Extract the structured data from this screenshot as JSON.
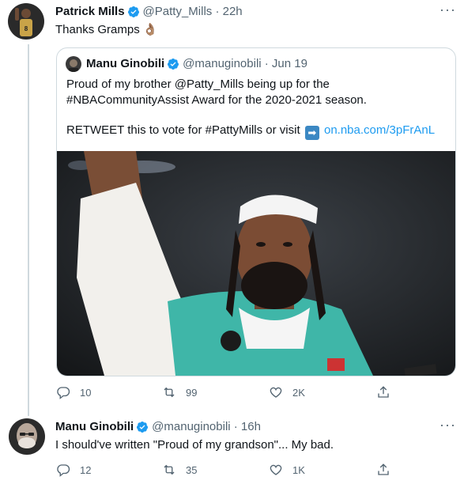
{
  "tweet1": {
    "name": "Patrick Mills",
    "handle": "@Patty_Mills · 22h",
    "text": "Thanks Gramps",
    "emoji": "👌🏽",
    "actions": {
      "reply": "10",
      "retweet": "99",
      "like": "2K"
    }
  },
  "quote": {
    "name": "Manu Ginobili",
    "handle": "@manuginobili · Jun 19",
    "line1": "Proud of my brother @Patty_Mills being up for the",
    "line2": "#NBACommunityAssist Award for the 2020-2021 season.",
    "line3_prefix": "RETWEET this to vote for #PattyMills or visit",
    "arrow": "➡",
    "link": "on.nba.com/3pFrAnL"
  },
  "tweet2": {
    "name": "Manu Ginobili",
    "handle": "@manuginobili · 16h",
    "text": "I should've written \"Proud of my grandson\"... My bad.",
    "actions": {
      "reply": "12",
      "retweet": "35",
      "like": "1K"
    }
  },
  "icons": {
    "verified_color": "#1d9bf0",
    "more": "···"
  }
}
